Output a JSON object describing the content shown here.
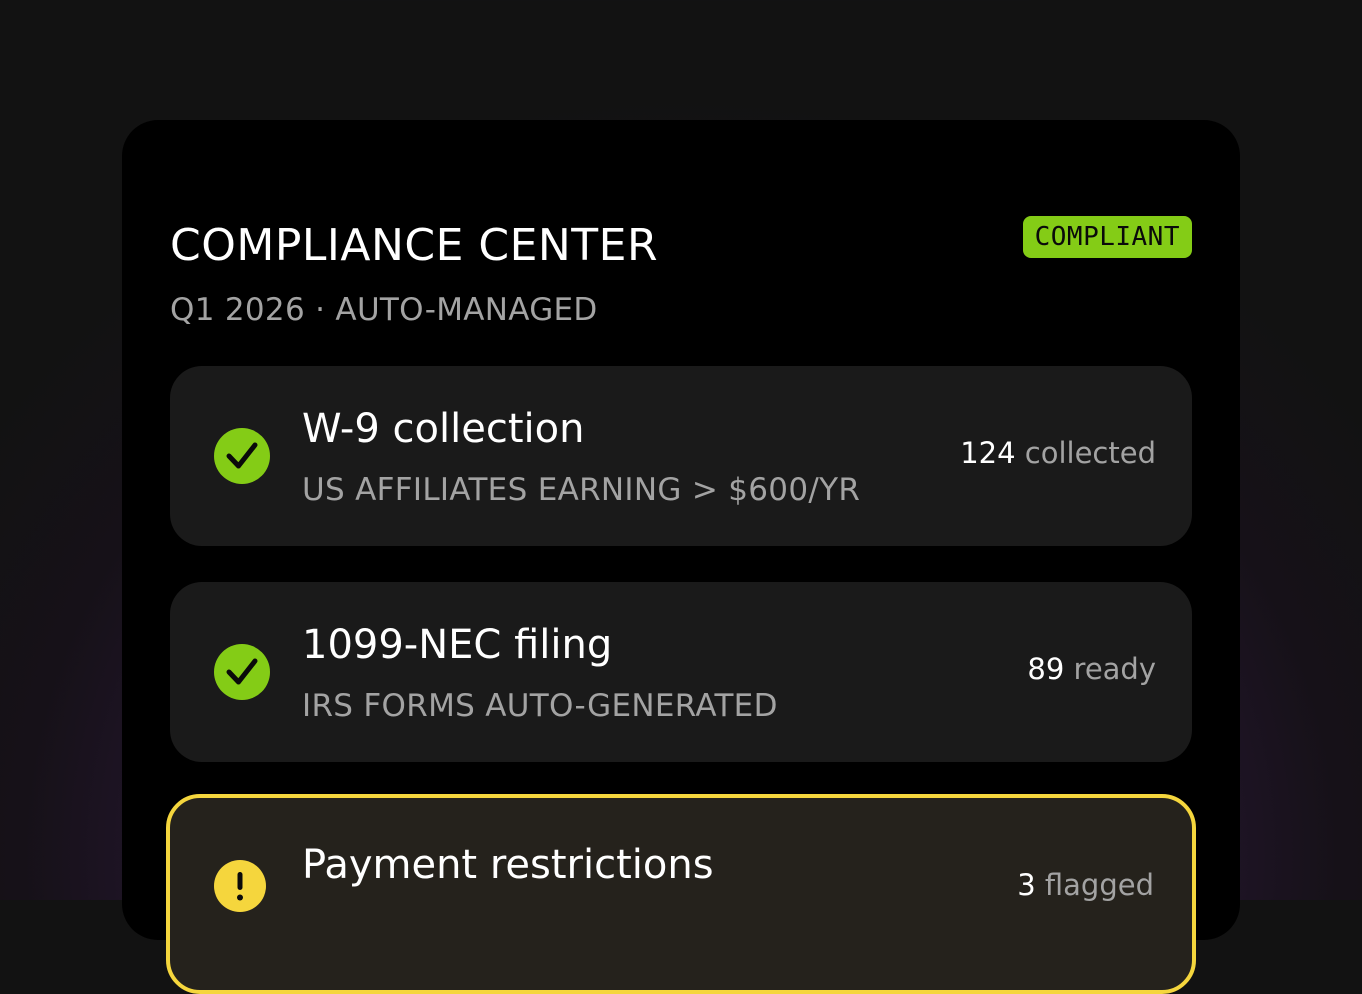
{
  "header": {
    "title": "COMPLIANCE CENTER",
    "subtitle": "Q1 2026 · AUTO-MANAGED",
    "status_badge": "COMPLIANT"
  },
  "colors": {
    "accent_green": "#84cc16",
    "warning_yellow": "#f5d63d",
    "muted_text": "#a3a3a3",
    "card_bg": "#1a1a1a"
  },
  "items": [
    {
      "title": "W-9 collection",
      "subtitle": "US AFFILIATES EARNING > $600/YR",
      "count_value": "124",
      "count_unit": "collected",
      "status": "ok",
      "icon": "check-circle-icon"
    },
    {
      "title": "1099-NEC filing",
      "subtitle": "IRS FORMS AUTO-GENERATED",
      "count_value": "89",
      "count_unit": "ready",
      "status": "ok",
      "icon": "check-circle-icon"
    },
    {
      "title": "Payment restrictions",
      "subtitle": "",
      "count_value": "3",
      "count_unit": "flagged",
      "status": "warning",
      "icon": "warning-circle-icon"
    }
  ]
}
